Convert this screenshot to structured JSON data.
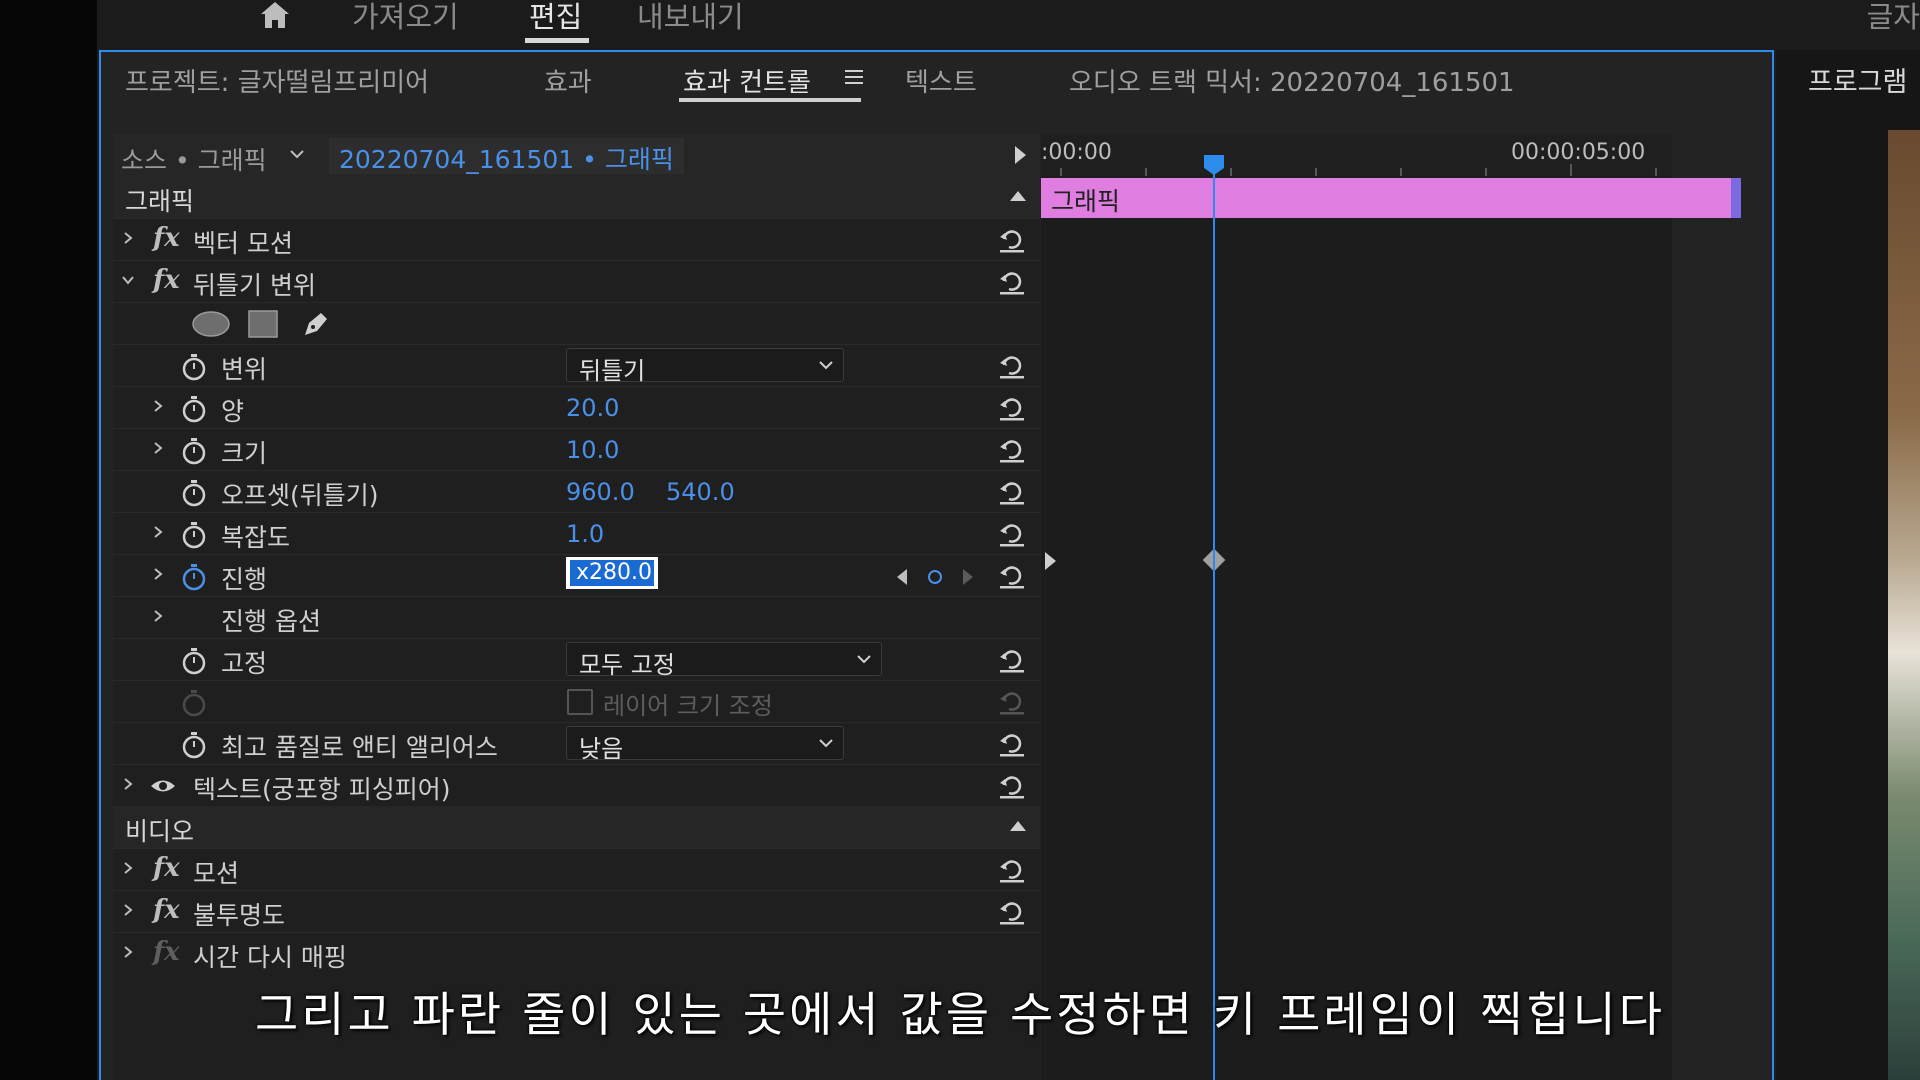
{
  "top_nav": {
    "items": [
      "가져오기",
      "편집",
      "내보내기"
    ],
    "active": "편집",
    "right_title": "글자"
  },
  "panel_tabs": {
    "project": "프로젝트: 글자떨림프리미어",
    "effects": "효과",
    "effect_controls": "효과 컨트롤",
    "text": "텍스트",
    "audio_mixer": "오디오 트랙 믹서: 20220704_161501"
  },
  "source": {
    "label": "소스 • 그래픽",
    "clip": "20220704_161501 • 그래픽"
  },
  "sections": {
    "graphics": "그래픽",
    "video": "비디오"
  },
  "effects": {
    "vector_motion": "벡터 모션",
    "turbulent_displace": "뒤틀기 변위",
    "text_layer": "텍스트(궁포항 피싱피어)",
    "motion": "모션",
    "opacity": "불투명도",
    "time_remap": "시간 다시 매핑"
  },
  "properties": {
    "displacement": {
      "label": "변위",
      "value": "뒤틀기"
    },
    "amount": {
      "label": "양",
      "value": "20.0"
    },
    "size": {
      "label": "크기",
      "value": "10.0"
    },
    "offset": {
      "label": "오프셋(뒤틀기)",
      "x": "960.0",
      "y": "540.0"
    },
    "complexity": {
      "label": "복잡도",
      "value": "1.0"
    },
    "evolution": {
      "label": "진행",
      "value": "x280.0"
    },
    "evolution_options": {
      "label": "진행 옵션"
    },
    "pinning": {
      "label": "고정",
      "value": "모두 고정"
    },
    "resize_layer": {
      "label": "레이어 크기 조정"
    },
    "antialias": {
      "label": "최고 품질로 앤티 앨리어스",
      "value": "낮음"
    }
  },
  "timeline": {
    "time_start": ":00:00",
    "time_5s": "00:00:05:00",
    "clip_label": "그래픽"
  },
  "program_monitor": {
    "title": "프로그램"
  },
  "subtitle": "그리고 파란 줄이 있는 곳에서 값을 수정하면 키 프레임이 찍힙니다",
  "colors": {
    "accent_blue": "#2d8ceb",
    "value_blue": "#4a90e8",
    "clip_pink": "#e07de0"
  }
}
